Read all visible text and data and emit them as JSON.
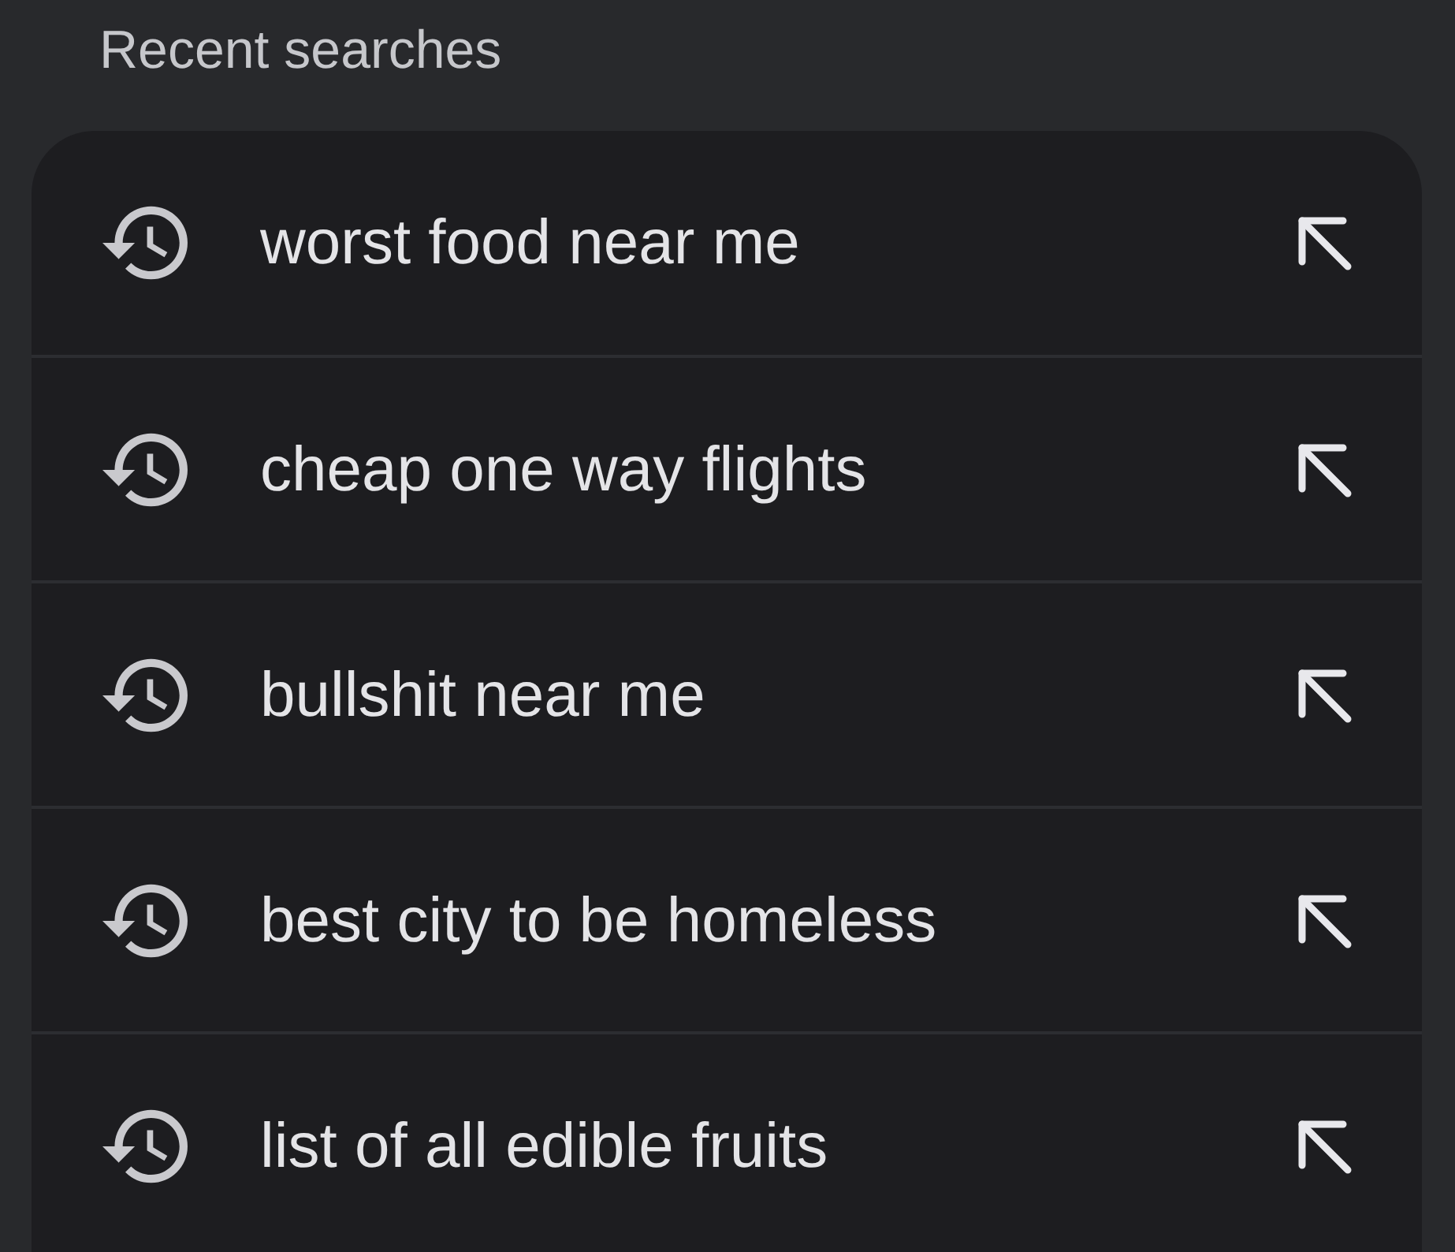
{
  "section_title": "Recent searches",
  "searches": [
    {
      "query": "worst food near me"
    },
    {
      "query": "cheap one way flights"
    },
    {
      "query": "bullshit near me"
    },
    {
      "query": "best city to be homeless"
    },
    {
      "query": "list of all edible fruits"
    }
  ]
}
